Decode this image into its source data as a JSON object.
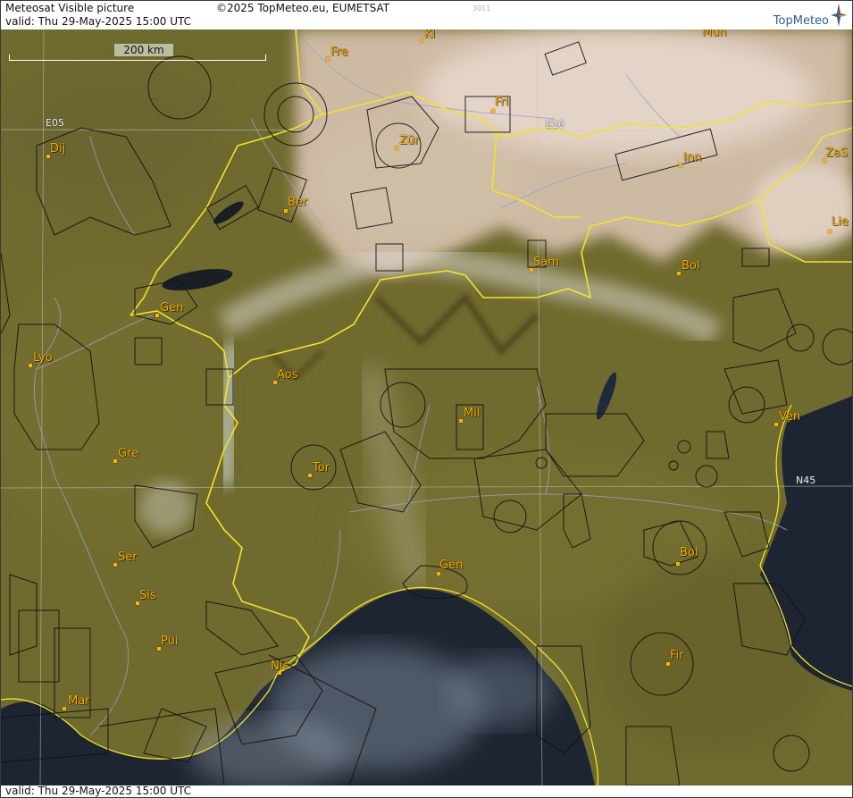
{
  "header": {
    "title": "Meteosat Visible picture",
    "valid": "valid:  Thu  29-May-2025  15:00 UTC",
    "copyright": "©2025 TopMeteo.eu, EUMETSAT",
    "code": "3011",
    "brand": "TopMeteo"
  },
  "footer": {
    "valid": "valid:  Thu  29-May-2025  15:00 UTC"
  },
  "map": {
    "scale_label": "200 km",
    "grid_labels": {
      "lon_e05": "E05",
      "lon_e10": "E10",
      "lat_n45": "N45"
    },
    "colors": {
      "land": "#6f6a2e",
      "sea": "#1d2533",
      "border": "#f2e22c",
      "river": "#9a9ec8",
      "airspace": "#111111",
      "city_label": "#ffb200",
      "grid": "#c8c8c8"
    },
    "cities": [
      "Fre",
      "Kl",
      "Mun",
      "Fri",
      "Zür",
      "Dij",
      "Ber",
      "Inn",
      "ZaS",
      "Lie",
      "Sam",
      "Bol",
      "Gen",
      "Lyo",
      "Aos",
      "Mil",
      "Ven",
      "Gre",
      "Tor",
      "Ser",
      "Gen",
      "Bol",
      "Sis",
      "Pui",
      "Nic",
      "Fir",
      "Mar"
    ]
  }
}
